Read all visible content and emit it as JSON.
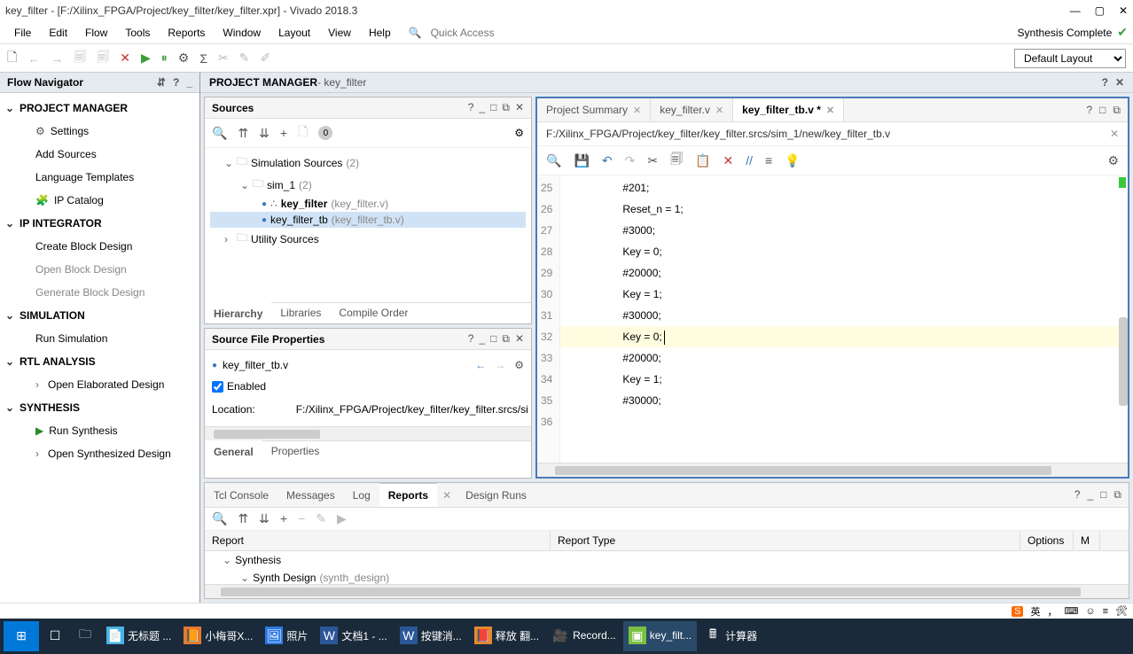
{
  "window": {
    "title": "key_filter - [F:/Xilinx_FPGA/Project/key_filter/key_filter.xpr] - Vivado 2018.3"
  },
  "menu": {
    "file": "File",
    "edit": "Edit",
    "flow": "Flow",
    "tools": "Tools",
    "reports": "Reports",
    "window": "Window",
    "layout": "Layout",
    "view": "View",
    "help": "Help",
    "quick_access_placeholder": "Quick Access",
    "status": "Synthesis Complete"
  },
  "toolbar": {
    "layout_label": "Default Layout"
  },
  "flow_nav": {
    "header": "Flow Navigator",
    "pm": "PROJECT MANAGER",
    "settings": "Settings",
    "add_sources": "Add Sources",
    "lang_templates": "Language Templates",
    "ip_catalog": "IP Catalog",
    "ip_int": "IP INTEGRATOR",
    "create_bd": "Create Block Design",
    "open_bd": "Open Block Design",
    "gen_bd": "Generate Block Design",
    "sim": "SIMULATION",
    "run_sim": "Run Simulation",
    "rtl": "RTL ANALYSIS",
    "open_elab": "Open Elaborated Design",
    "synth": "SYNTHESIS",
    "run_synth": "Run Synthesis",
    "open_synth": "Open Synthesized Design"
  },
  "pm_header": {
    "title": "PROJECT MANAGER",
    "sub": " - key_filter"
  },
  "sources": {
    "title": "Sources",
    "count0": "0",
    "sim_sources": "Simulation Sources",
    "sim_sources_count": "(2)",
    "sim1": "sim_1",
    "sim1_count": "(2)",
    "key_filter": "key_filter",
    "key_filter_file": "(key_filter.v)",
    "key_filter_tb": "key_filter_tb",
    "key_filter_tb_file": "(key_filter_tb.v)",
    "utility": "Utility Sources",
    "tab_hierarchy": "Hierarchy",
    "tab_libraries": "Libraries",
    "tab_compile": "Compile Order"
  },
  "sfp": {
    "title": "Source File Properties",
    "file": "key_filter_tb.v",
    "enabled": "Enabled",
    "location_label": "Location:",
    "location_value": "F:/Xilinx_FPGA/Project/key_filter/key_filter.srcs/si",
    "tab_general": "General",
    "tab_properties": "Properties"
  },
  "editor": {
    "tab_summary": "Project Summary",
    "tab_kf": "key_filter.v",
    "tab_kftb": "key_filter_tb.v *",
    "path": "F:/Xilinx_FPGA/Project/key_filter/key_filter.srcs/sim_1/new/key_filter_tb.v",
    "code": {
      "25": "#201;",
      "26": "Reset_n = 1;",
      "27": "#3000;",
      "28": "Key = 0;",
      "29": "#20000;",
      "30": "Key = 1;",
      "31": "#30000;",
      "32": "Key = 0;",
      "33": "#20000;",
      "34": "Key = 1;",
      "35": "#30000;",
      "36": ""
    }
  },
  "bottom": {
    "tcl": "Tcl Console",
    "messages": "Messages",
    "log": "Log",
    "reports": "Reports",
    "design_runs": "Design Runs",
    "col_report": "Report",
    "col_type": "Report Type",
    "col_options": "Options",
    "col_m": "M",
    "row_synth": "Synthesis",
    "row_synth_design": "Synth Design",
    "row_synth_design_hint": "(synth_design)"
  },
  "ime": {
    "s": "S",
    "lang": "英",
    "punct1": "，",
    "punct2": "。",
    "punct3": "，"
  },
  "taskbar": {
    "untitled": "无标题 ...",
    "xiaomei": "小梅哥X...",
    "photos": "照片",
    "word1": "文档1 - ...",
    "word2": "按键消...",
    "dict": "释放 翻...",
    "record": "Record...",
    "vivado": "key_filt...",
    "calc": "计算器"
  }
}
